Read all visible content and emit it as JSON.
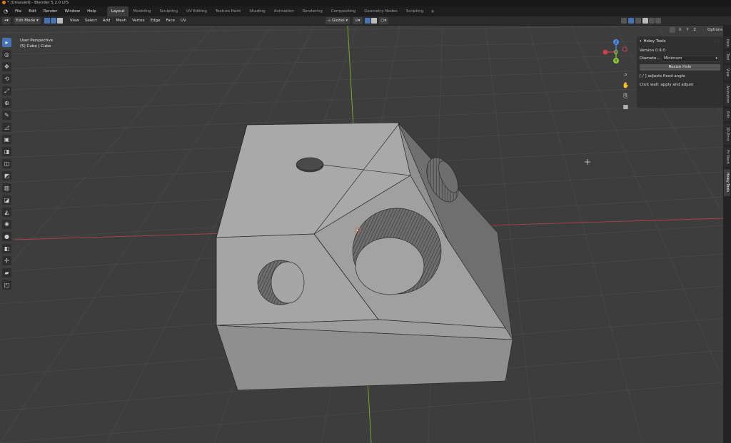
{
  "window": {
    "title": "* [Unsaved] - Blender 5.2.0 LTS"
  },
  "menus": [
    "File",
    "Edit",
    "Render",
    "Window",
    "Help"
  ],
  "workspaces": [
    {
      "label": "Layout",
      "active": true
    },
    {
      "label": "Modeling"
    },
    {
      "label": "Sculpting"
    },
    {
      "label": "UV Editing"
    },
    {
      "label": "Texture Paint"
    },
    {
      "label": "Shading"
    },
    {
      "label": "Animation"
    },
    {
      "label": "Rendering"
    },
    {
      "label": "Compositing"
    },
    {
      "label": "Geometry Nodes"
    },
    {
      "label": "Scripting"
    }
  ],
  "header": {
    "mode": "Edit Mode",
    "menu": [
      "View",
      "Select",
      "Add",
      "Mesh",
      "Vertex",
      "Edge",
      "Face",
      "UV"
    ],
    "transform_orientation": "Global",
    "axes": [
      "X",
      "Y",
      "Z"
    ],
    "options_label": "Options"
  },
  "viewport": {
    "perspective": "User Perspective",
    "object": "(5) Cube | Cube",
    "accent": "#4772b3",
    "axis_x_color": "#c8424e",
    "axis_y_color": "#8cc832",
    "axis_z_color": "#4f8ce8"
  },
  "gizmo": {
    "x": "X",
    "y": "Y",
    "z": "Z"
  },
  "tools": [
    "select-box",
    "cursor",
    "move",
    "rotate",
    "scale",
    "transform",
    "annotate",
    "measure",
    "add-cube",
    "extrude",
    "inset",
    "bevel",
    "loop-cut",
    "knife",
    "poly-build",
    "spin",
    "smooth",
    "edge-slide",
    "shrink-fatten",
    "shear",
    "rip"
  ],
  "navtools": [
    "zoom",
    "pan",
    "camera",
    "perspective"
  ],
  "npanel": {
    "title": "Holey Tools",
    "version": "Version 0.9.0",
    "diameter_label": "Diamete...",
    "diameter_value": "Minimum",
    "resize_button": "Resize Hole",
    "hint1": "[ / ] adjusts flood angle",
    "hint2": "Click wall: apply and adjust"
  },
  "tabs": [
    {
      "label": "Item"
    },
    {
      "label": "Tool"
    },
    {
      "label": "View"
    },
    {
      "label": "Animation"
    },
    {
      "label": "Edit"
    },
    {
      "label": "3D-Print"
    },
    {
      "label": "Fit Mesh"
    },
    {
      "label": "Holey Tools",
      "active": true
    }
  ]
}
